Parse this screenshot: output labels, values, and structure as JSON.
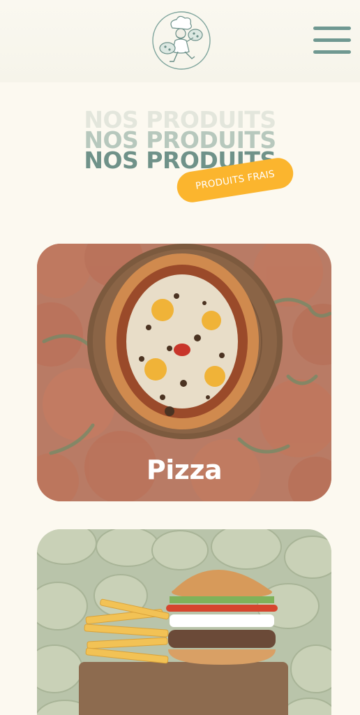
{
  "header": {
    "logo_icon": "chef-mascot-logo-icon",
    "menu_icon": "hamburger-menu-icon"
  },
  "section": {
    "title_lines": [
      "NOS PRODUITS",
      "NOS PRODUITS",
      "NOS PRODUITS"
    ],
    "badge": "PRODUITS FRAIS"
  },
  "products": [
    {
      "label": "Pizza",
      "background": "tomatoes",
      "image": "pizza-image"
    },
    {
      "label": "",
      "background": "potatoes",
      "image": "burger-fries-image"
    }
  ],
  "colors": {
    "background": "#fcf9f0",
    "accent_teal": "#6f9289",
    "badge_yellow": "#fbb52e"
  }
}
